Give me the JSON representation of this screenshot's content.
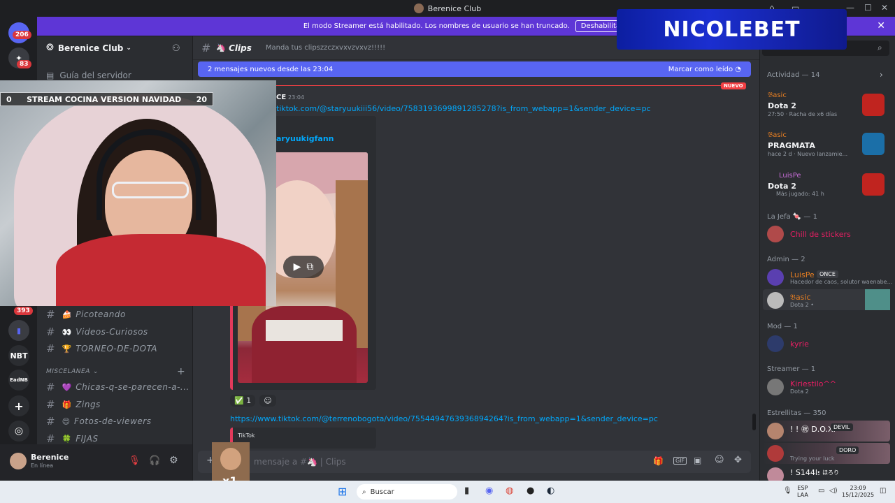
{
  "window": {
    "title": "Berenice Club",
    "min": "—",
    "max": "☐",
    "close": "✕"
  },
  "guilds": {
    "home_badge": "206",
    "g2_badge": "83",
    "g3_badge": "393",
    "nbt_label": "NBT",
    "eadnb_label": "EadNB"
  },
  "streamer_banner": {
    "text": "El modo Streamer está habilitado. Los nombres de usuario se han truncado.",
    "button": "Deshabilitar"
  },
  "server": {
    "name": "Berenice Club"
  },
  "sidebar": {
    "guide": "Guía del servidor",
    "channels": [
      {
        "emoji": "🍰",
        "name": "Picoteando"
      },
      {
        "emoji": "👀",
        "name": "Videos-Curiosos"
      },
      {
        "emoji": "🏆",
        "name": "TORNEO-DE-DOTA"
      }
    ],
    "category": "MISCELANEA",
    "misc_channels": [
      {
        "emoji": "💜",
        "name": "Chicas-q-se-parecen-a-..."
      },
      {
        "emoji": "🎁",
        "name": "Zings"
      },
      {
        "emoji": "😍",
        "name": "Fotos-de-viewers"
      },
      {
        "emoji": "🍀",
        "name": "FIJAS"
      }
    ]
  },
  "user": {
    "name": "Berenice",
    "status": "En línea"
  },
  "channel": {
    "name": "Clips",
    "emoji": "🦄",
    "topic": "Manda tus clipszzczxvxvzvxvz!!!!!"
  },
  "new_messages": {
    "text": "2 mensajes nuevos desde las 23:04",
    "action": "Marcar como leído",
    "badge": "NUEVO"
  },
  "message": {
    "author": "CE",
    "time": "23:04",
    "link1": "tiktok.com/@staryuukiii56/video/7583193699891285278?is_from_webapp=1&sender_device=pc",
    "embed_author": "aryuukigfann",
    "reaction_count": "1",
    "link2": "https://www.tiktok.com/@terrenobogota/video/7554494763936894264?is_from_webapp=1&sender_device=pc",
    "embed2_provider": "TikTok"
  },
  "input": {
    "placeholder": "mensaje a #🦄 | Clips"
  },
  "webcam": {
    "overlay_left": "0",
    "overlay_title": "STREAM COCINA VERSION NAVIDAD",
    "overlay_right": "20"
  },
  "brand_overlay": {
    "text": "NICOLEBET"
  },
  "members": {
    "activity_header": "Actividad — 14",
    "activities": [
      {
        "user": "𝔅asic",
        "game": "Dota 2",
        "detail": "27:50 · Racha de x6 días"
      },
      {
        "user": "𝔅asic",
        "game": "PRAGMATA",
        "detail": "hace 2 d · Nuevo lanzamie..."
      },
      {
        "user": "LuisPe",
        "game": "Dota 2",
        "detail": "Más jugado: 41 h"
      }
    ],
    "sec_jefa": "La Jefa 🍬 — 1",
    "jefa_member": "Chill de stickers",
    "sec_admin": "Admin — 2",
    "admin1": "LuisPe",
    "admin1_tag": "ONCE",
    "admin1_sub": "Hacedor de caos, solutor waenabe...",
    "admin2": "𝔅asic",
    "admin2_sub": "Dota 2 •",
    "sec_mod": "Mod — 1",
    "mod1": "kyrie",
    "sec_streamer": "Streamer — 1",
    "streamer1": "Kiriestilo^^",
    "streamer1_sub": "Dota 2",
    "sec_estrellitas": "Estrellitas — 350",
    "star1": "! ! ㊗ D.O.X.",
    "star1_tag": "DEVIL",
    "star2_tag": "DORO",
    "star2_sub": "Trying your luck",
    "star3": "! S144ls",
    "star3_tag": "ほろり"
  },
  "taskbar": {
    "search": "Buscar",
    "lang1": "ESP",
    "lang2": "LAA",
    "time": "23:09",
    "date": "15/12/2025"
  }
}
